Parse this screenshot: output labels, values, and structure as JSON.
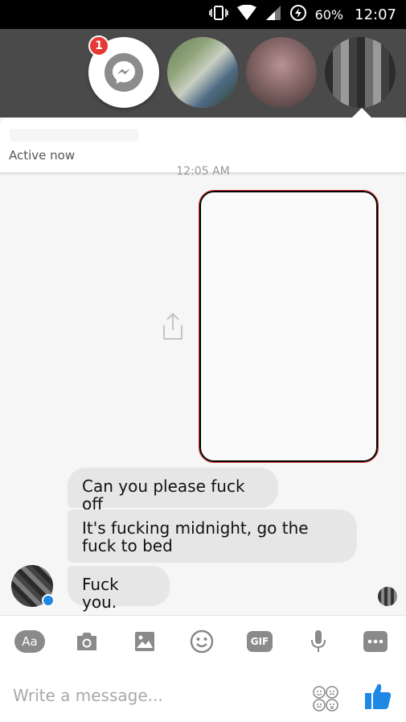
{
  "status_bar": {
    "battery_percent": "60%",
    "time": "12:07"
  },
  "chat_heads": {
    "badge_count": "1"
  },
  "header": {
    "status": "Active now"
  },
  "thread": {
    "timestamp": "12:05 AM",
    "messages": [
      "Can you please fuck off",
      "It's fucking midnight, go the fuck to bed",
      "Fuck you."
    ]
  },
  "composer": {
    "text_button": "Aa",
    "gif_button": "GIF",
    "placeholder": "Write a message...",
    "tools": [
      "text-format-icon",
      "camera-icon",
      "image-icon",
      "emoji-icon",
      "gif-icon",
      "microphone-icon",
      "more-icon"
    ]
  },
  "colors": {
    "like_blue": "#1e88e5",
    "badge_red": "#e53935",
    "bubble_gray": "#e6e6e6"
  }
}
